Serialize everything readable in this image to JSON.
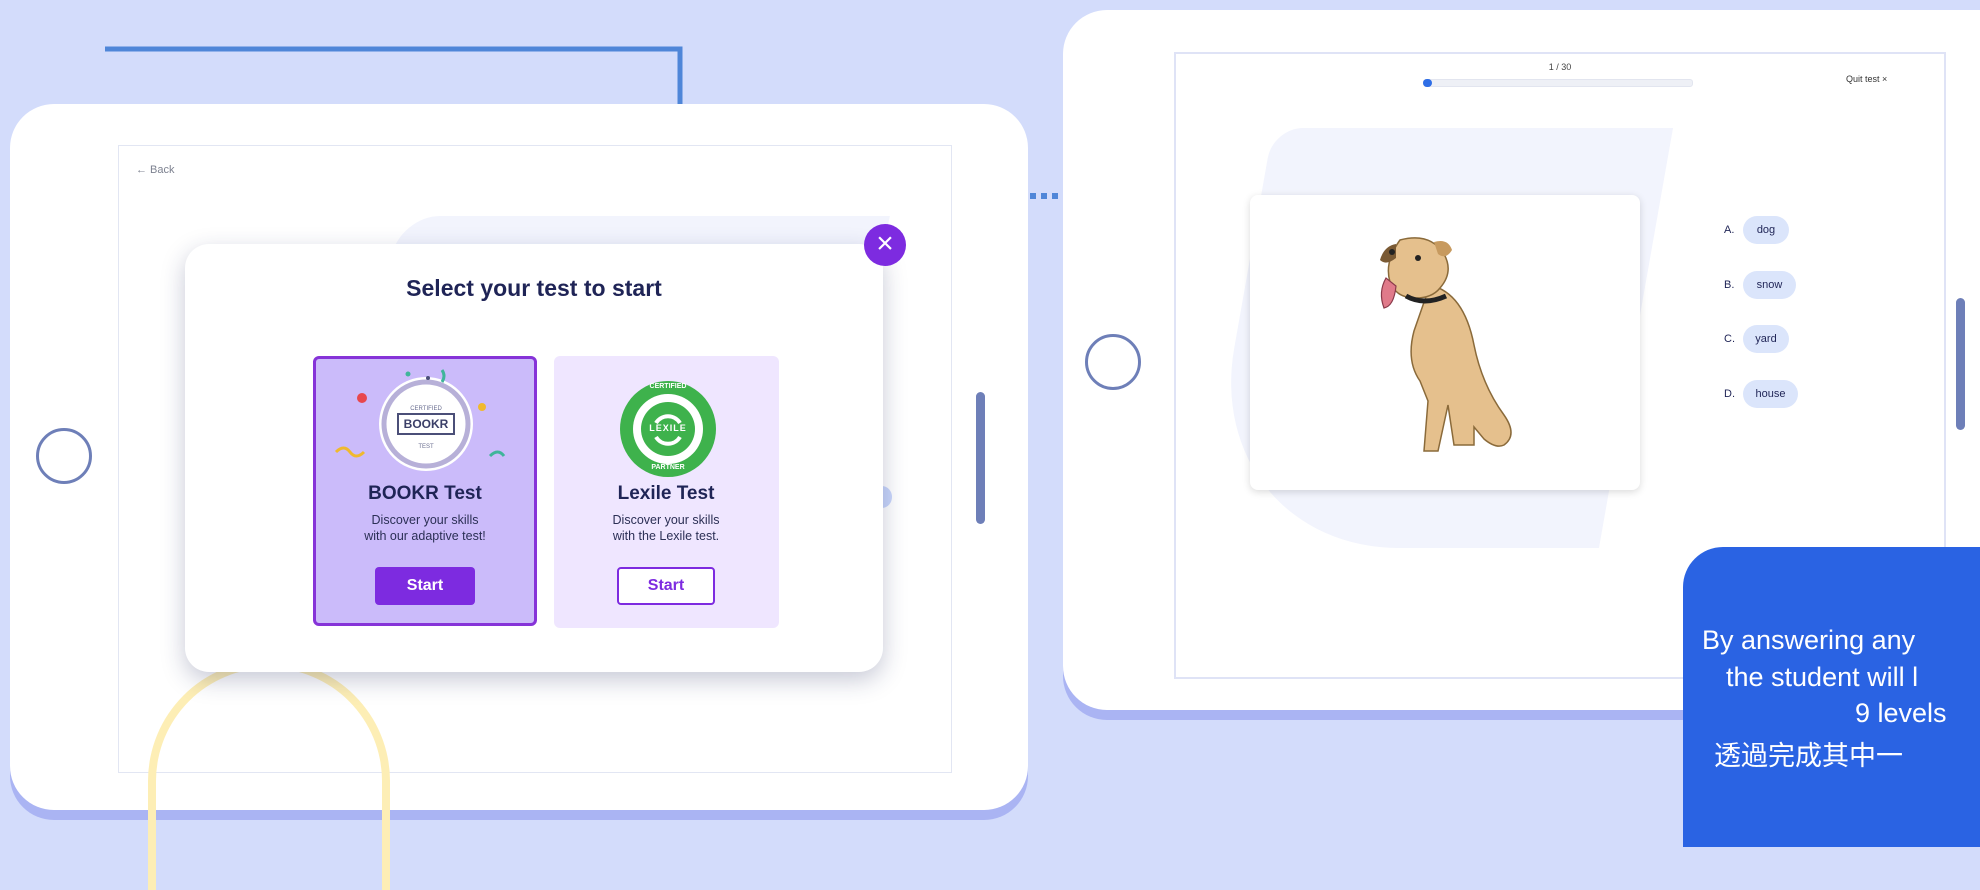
{
  "colors": {
    "background": "#d3dcfb",
    "accent_purple": "#7d2be0",
    "arrow_blue": "#4f86d8",
    "progress_blue": "#2f6ee6",
    "info_box_blue": "#2a63e3"
  },
  "left_tablet": {
    "back_label": "← Back",
    "modal": {
      "title": "Select your test to start",
      "close_icon": "close-icon",
      "cards": [
        {
          "title": "BOOKR Test",
          "desc_line1": "Discover your skills",
          "desc_line2": "with our adaptive test!",
          "button_label": "Start",
          "badge": {
            "top": "CERTIFIED",
            "center": "BOOKR",
            "bottom": "TEST"
          }
        },
        {
          "title": "Lexile Test",
          "desc_line1": "Discover your skills",
          "desc_line2": "with the Lexile test.",
          "button_label": "Start",
          "badge": {
            "top": "CERTIFIED",
            "center": "LEXILE",
            "bottom": "PARTNER"
          }
        }
      ]
    }
  },
  "right_tablet": {
    "progress": {
      "label": "1 / 30",
      "fraction": 0.033
    },
    "quit_label": "Quit test ×",
    "answers": [
      {
        "letter": "A.",
        "text": "dog"
      },
      {
        "letter": "B.",
        "text": "snow"
      },
      {
        "letter": "C.",
        "text": "yard"
      },
      {
        "letter": "D.",
        "text": "house"
      }
    ]
  },
  "info_box": {
    "line1": "By answering any",
    "line2": "the student will l",
    "line3": "9 levels",
    "line4": "透過完成其中一"
  }
}
